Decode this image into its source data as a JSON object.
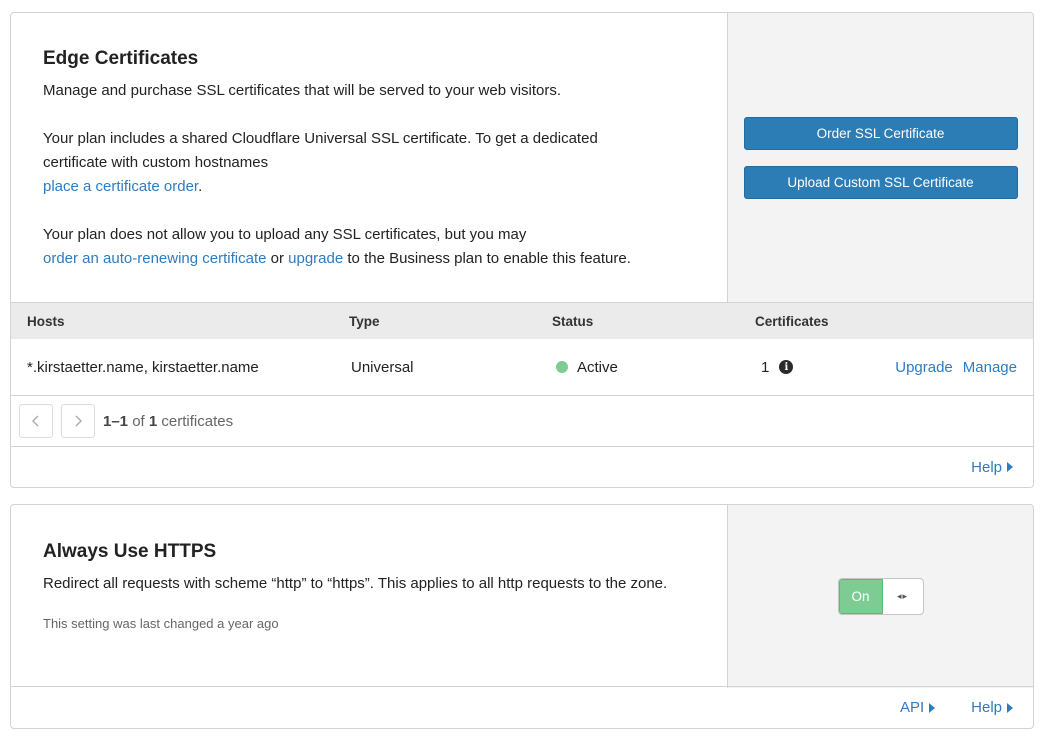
{
  "edge": {
    "title": "Edge Certificates",
    "description": "Manage and purchase SSL certificates that will be served to your web visitors.",
    "plan_text_1": "Your plan includes a shared Cloudflare Universal SSL certificate. To get a dedicated certificate with custom hostnames",
    "plan_link_1": "place a certificate order",
    "plan_text_1_end": ".",
    "plan_text_2": "Your plan does not allow you to upload any SSL certificates, but you may",
    "plan_link_2": "order an auto-renewing certificate",
    "plan_text_2_mid": " or ",
    "plan_link_3": "upgrade",
    "plan_text_2_end": " to the Business plan to enable this feature.",
    "order_button": "Order SSL Certificate",
    "upload_button": "Upload Custom SSL Certificate",
    "table": {
      "headers": {
        "hosts": "Hosts",
        "type": "Type",
        "status": "Status",
        "certificates": "Certificates"
      },
      "rows": [
        {
          "hosts": "*.kirstaetter.name, kirstaetter.name",
          "type": "Universal",
          "status": "Active",
          "certificates": "1",
          "upgrade": "Upgrade",
          "manage": "Manage"
        }
      ],
      "status_color": "#7ccc93"
    },
    "pager": {
      "prev_icon": "chevron-left-icon",
      "next_icon": "chevron-right-icon",
      "range": "1–1",
      "of": " of ",
      "total": "1",
      "suffix": " certificates"
    },
    "help_link": "Help"
  },
  "https": {
    "title": "Always Use HTTPS",
    "description": "Redirect all requests with scheme “http” to “https”. This applies to all http requests to the zone.",
    "last_changed": "This setting was last changed a year ago",
    "toggle_label": "On",
    "api_link": "API",
    "help_link": "Help"
  },
  "colors": {
    "primary_button": "#2c7cb5",
    "link": "#2f7bbf",
    "toggle_on": "#7ccc93",
    "side_panel": "#f3f3f3"
  }
}
